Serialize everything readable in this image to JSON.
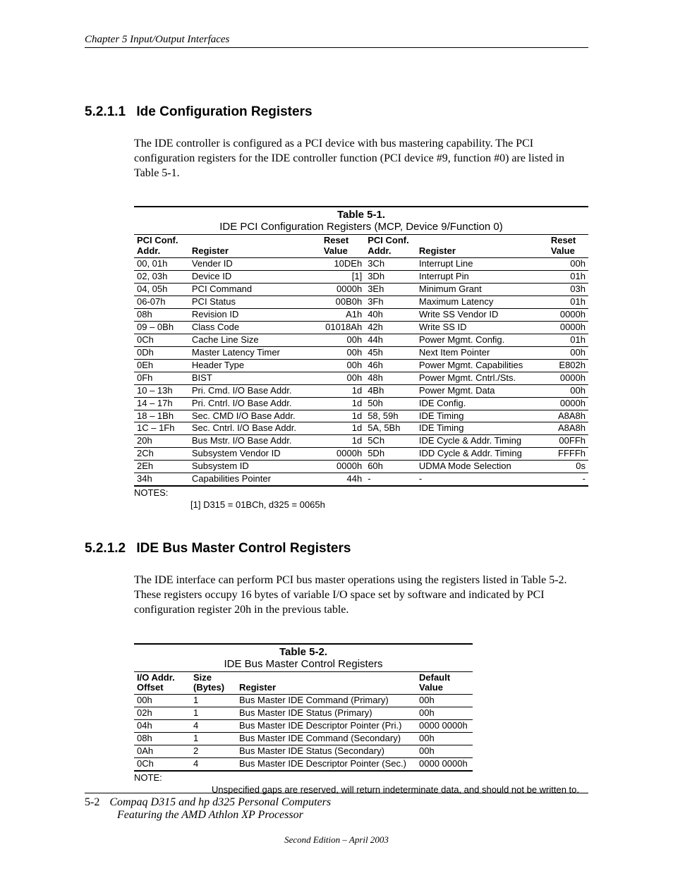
{
  "header": {
    "chapter": "Chapter 5  Input/Output Interfaces"
  },
  "section1": {
    "number": "5.2.1.1",
    "title": "Ide Configuration Registers",
    "para": "The IDE controller is configured as a PCI device with bus mastering capability. The PCI configuration registers for the IDE controller function (PCI device #9, function #0) are listed in Table 5-1."
  },
  "table1": {
    "caption": "Table 5-1.",
    "title": "IDE PCI Configuration Registers (MCP, Device 9/Function 0)",
    "head": {
      "addr1a": "PCI Conf.",
      "addr1b": "Addr.",
      "reg": "Register",
      "reset1a": "Reset",
      "reset1b": "Value",
      "addr2a": "PCI Conf.",
      "addr2b": "Addr.",
      "reg2": "Register",
      "reset2a": "Reset",
      "reset2b": "Value"
    },
    "rows": [
      [
        "00, 01h",
        "Vender ID",
        "10DEh",
        "3Ch",
        "Interrupt Line",
        "00h"
      ],
      [
        "02, 03h",
        "Device ID",
        "[1]",
        "3Dh",
        "Interrupt Pin",
        "01h"
      ],
      [
        "04, 05h",
        "PCI Command",
        "0000h",
        "3Eh",
        "Minimum Grant",
        "03h"
      ],
      [
        "06-07h",
        "PCI Status",
        "00B0h",
        "3Fh",
        "Maximum Latency",
        "01h"
      ],
      [
        "08h",
        "Revision ID",
        "A1h",
        "40h",
        "Write SS Vendor ID",
        "0000h"
      ],
      [
        "09 – 0Bh",
        "Class Code",
        "01018Ah",
        "42h",
        "Write SS ID",
        "0000h"
      ],
      [
        "0Ch",
        "Cache Line Size",
        "00h",
        "44h",
        "Power Mgmt. Config.",
        "01h"
      ],
      [
        "0Dh",
        "Master Latency Timer",
        "00h",
        "45h",
        "Next Item Pointer",
        "00h"
      ],
      [
        "0Eh",
        "Header Type",
        "00h",
        "46h",
        "Power Mgmt. Capabilities",
        "E802h"
      ],
      [
        "0Fh",
        "BIST",
        "00h",
        "48h",
        "Power Mgmt. Cntrl./Sts.",
        "0000h"
      ],
      [
        "10 – 13h",
        "Pri. Cmd. I/O Base Addr.",
        "1d",
        "4Bh",
        "Power Mgmt. Data",
        "00h"
      ],
      [
        "14 – 17h",
        "Pri. Cntrl. I/O Base Addr.",
        "1d",
        "50h",
        "IDE Config.",
        "0000h"
      ],
      [
        "18 – 1Bh",
        "Sec. CMD I/O Base Addr.",
        "1d",
        "58, 59h",
        "IDE Timing",
        "A8A8h"
      ],
      [
        "1C – 1Fh",
        "Sec. Cntrl. I/O Base Addr.",
        "1d",
        "5A, 5Bh",
        "IDE Timing",
        "A8A8h"
      ],
      [
        "20h",
        "Bus Mstr. I/O Base Addr.",
        "1d",
        "5Ch",
        "IDE Cycle & Addr. Timing",
        "00FFh"
      ],
      [
        "2Ch",
        "Subsystem Vendor ID",
        "0000h",
        "5Dh",
        "IDD Cycle & Addr. Timing",
        "FFFFh"
      ],
      [
        "2Eh",
        "Subsystem ID",
        "0000h",
        "60h",
        "UDMA Mode Selection",
        "0s"
      ],
      [
        "34h",
        "Capabilities Pointer",
        "44h",
        "-",
        "-",
        "-"
      ]
    ],
    "notes_label": "NOTES:",
    "notes_body": "[1]  D315 = 01BCh,  d325 = 0065h"
  },
  "section2": {
    "number": "5.2.1.2",
    "title": "IDE Bus Master Control Registers",
    "para": "The IDE interface can perform PCI bus master operations using the registers listed in Table 5-2. These registers occupy 16 bytes of variable I/O space set by software and indicated by PCI configuration register 20h in the previous table."
  },
  "table2": {
    "caption": "Table 5-2.",
    "title": "IDE Bus Master Control Registers",
    "head": {
      "c1a": "I/O Addr.",
      "c1b": "Offset",
      "c2a": "Size",
      "c2b": "(Bytes)",
      "c3": "Register",
      "c4a": "Default",
      "c4b": "Value"
    },
    "rows": [
      [
        "00h",
        "1",
        "Bus Master IDE Command (Primary)",
        "00h"
      ],
      [
        "02h",
        "1",
        "Bus Master IDE Status (Primary)",
        "00h"
      ],
      [
        "04h",
        "4",
        "Bus Master IDE Descriptor Pointer (Pri.)",
        "0000 0000h"
      ],
      [
        "08h",
        "1",
        "Bus Master IDE Command (Secondary)",
        "00h"
      ],
      [
        "0Ah",
        "2",
        "Bus Master IDE Status (Secondary)",
        "00h"
      ],
      [
        "0Ch",
        "4",
        "Bus Master IDE Descriptor Pointer (Sec.)",
        "0000 0000h"
      ]
    ],
    "notes_label": "NOTE:",
    "notes_body": "Unspecified gaps are reserved, will return indeterminate data, and should not be written to."
  },
  "footer": {
    "page_num": "5-2",
    "line1": "Compaq D315 and hp d325 Personal Computers",
    "line2": "Featuring the AMD Athlon XP Processor",
    "edition": "Second Edition – April 2003"
  }
}
